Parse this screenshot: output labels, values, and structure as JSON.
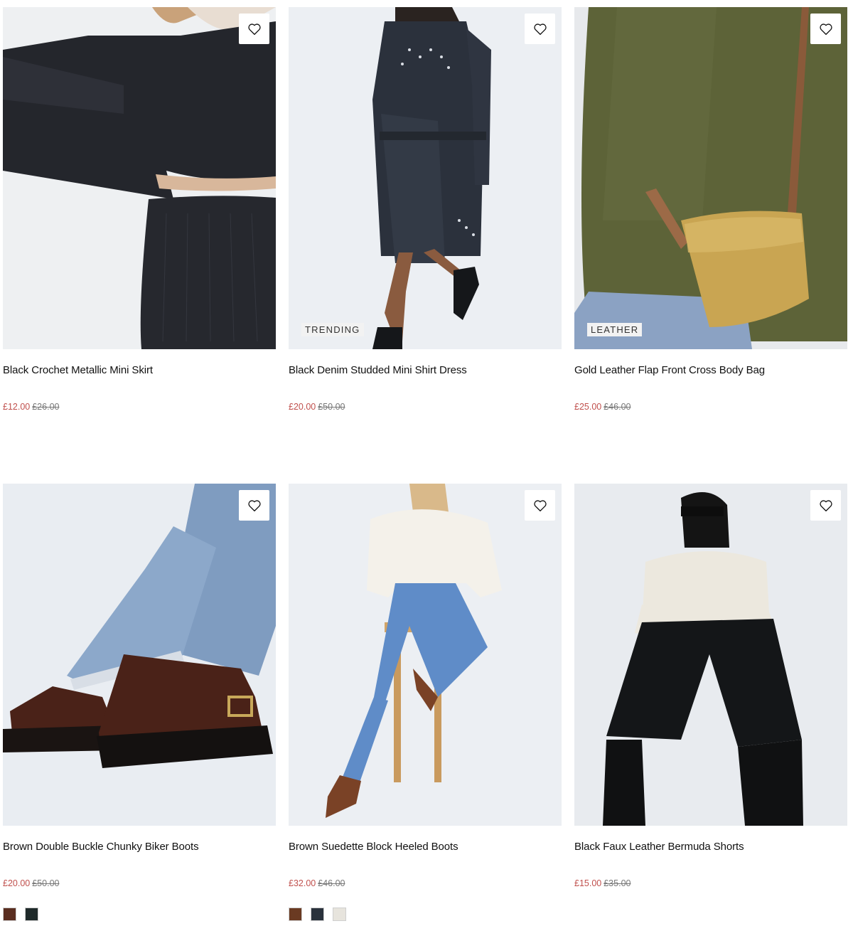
{
  "products": [
    {
      "title": "Black Crochet Metallic Mini Skirt",
      "price_now": "£12.00",
      "price_was": "£26.00",
      "tag": "",
      "image": "black-crochet-set-photo",
      "swatches": []
    },
    {
      "title": "Black Denim Studded Mini Shirt Dress",
      "price_now": "£20.00",
      "price_was": "£50.00",
      "tag": "TRENDING",
      "image": "denim-shirt-dress-photo",
      "swatches": []
    },
    {
      "title": "Gold Leather Flap Front Cross Body Bag",
      "price_now": "£25.00",
      "price_was": "£46.00",
      "tag": "LEATHER",
      "image": "gold-bag-photo",
      "swatches": []
    },
    {
      "title": "Brown Double Buckle Chunky Biker Boots",
      "price_now": "£20.00",
      "price_was": "£50.00",
      "tag": "",
      "image": "biker-boots-photo",
      "swatches": [
        "#5a2e20",
        "#1f2a2a"
      ]
    },
    {
      "title": "Brown Suedette Block Heeled Boots",
      "price_now": "£32.00",
      "price_was": "£46.00",
      "tag": "",
      "image": "heeled-boots-photo",
      "swatches": [
        "#6a3a22",
        "#2a323c",
        "#e7e4dd"
      ]
    },
    {
      "title": "Black Faux Leather Bermuda Shorts",
      "price_now": "£15.00",
      "price_was": "£35.00",
      "tag": "",
      "image": "bermuda-shorts-photo",
      "swatches": []
    }
  ],
  "icons": {
    "wishlist": "heart-outline-icon"
  },
  "colors": {
    "sale_price": "#c0504d",
    "was_price": "#777777"
  }
}
